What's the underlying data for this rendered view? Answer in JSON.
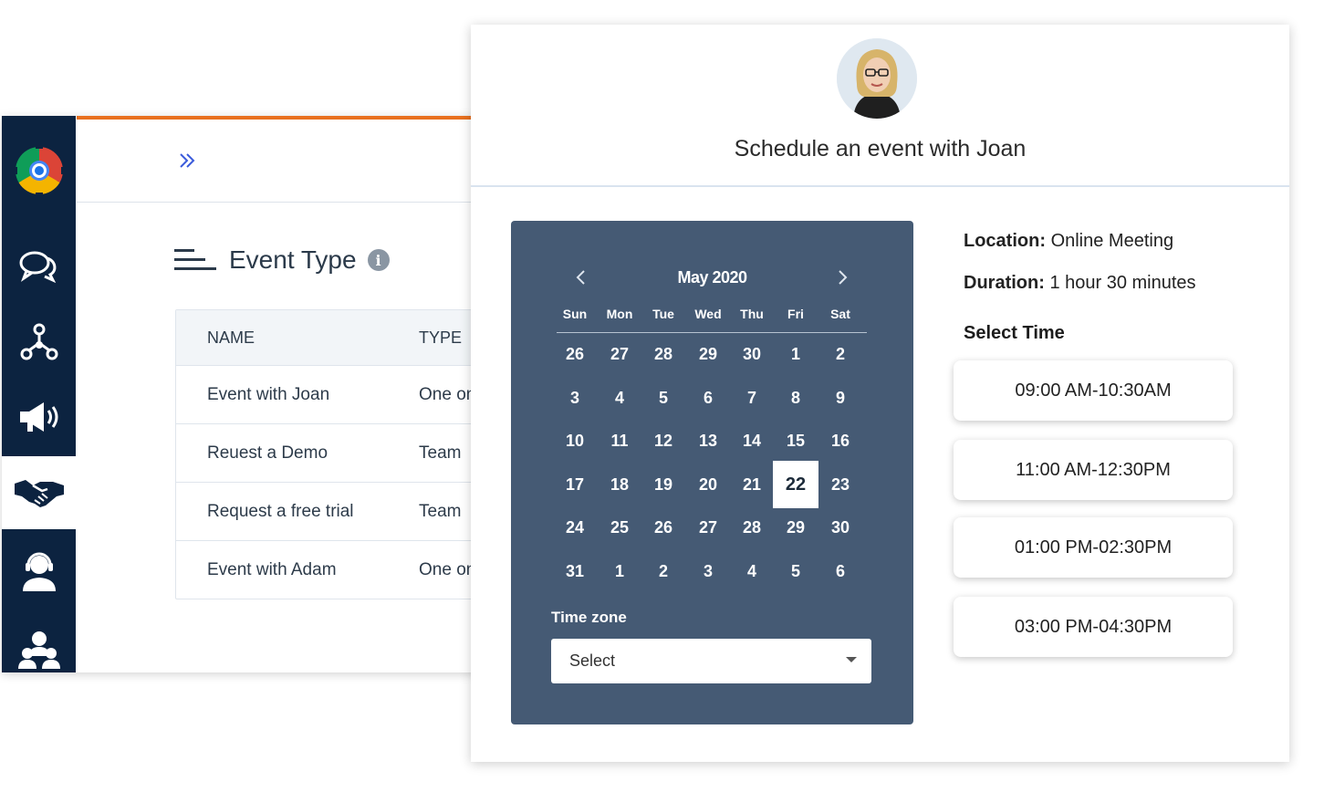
{
  "app": {
    "sidebar": {
      "items": [
        {
          "icon": "logo-gear-icon"
        },
        {
          "icon": "chat-icon"
        },
        {
          "icon": "network-icon"
        },
        {
          "icon": "megaphone-icon"
        },
        {
          "icon": "handshake-icon",
          "active": true
        },
        {
          "icon": "support-agent-icon"
        },
        {
          "icon": "team-icon"
        }
      ]
    },
    "header": {
      "expand_icon": "double-chevron-right-icon"
    },
    "section": {
      "title": "Event Type",
      "info_icon": "info-icon",
      "menu_icon": "menu-lines-icon"
    },
    "table": {
      "headers": {
        "name": "NAME",
        "type": "TYPE"
      },
      "rows": [
        {
          "name": "Event with Joan",
          "type": "One on"
        },
        {
          "name": "Reuest a Demo",
          "type": "Team"
        },
        {
          "name": "Request a free trial",
          "type": "Team"
        },
        {
          "name": "Event with Adam",
          "type": "One on"
        }
      ]
    }
  },
  "scheduler": {
    "title": "Schedule an event with Joan",
    "calendar": {
      "month_label": "May 2020",
      "weekdays": [
        "Sun",
        "Mon",
        "Tue",
        "Wed",
        "Thu",
        "Fri",
        "Sat"
      ],
      "weeks": [
        [
          "26",
          "27",
          "28",
          "29",
          "30",
          "1",
          "2"
        ],
        [
          "3",
          "4",
          "5",
          "6",
          "7",
          "8",
          "9"
        ],
        [
          "10",
          "11",
          "12",
          "13",
          "14",
          "15",
          "16"
        ],
        [
          "17",
          "18",
          "19",
          "20",
          "21",
          "22",
          "23"
        ],
        [
          "24",
          "25",
          "26",
          "27",
          "28",
          "29",
          "30"
        ],
        [
          "31",
          "1",
          "2",
          "3",
          "4",
          "5",
          "6"
        ]
      ],
      "selected_day": "22",
      "timezone_label": "Time zone",
      "timezone_value": "Select"
    },
    "location": {
      "label": "Location:",
      "value": "Online Meeting"
    },
    "duration": {
      "label": "Duration:",
      "value": "1 hour 30 minutes"
    },
    "select_time_label": "Select Time",
    "slots": [
      "09:00 AM-10:30AM",
      "11:00 AM-12:30PM",
      "01:00 PM-02:30PM",
      "03:00 PM-04:30PM"
    ]
  },
  "colors": {
    "sidebar": "#0c2340",
    "accent": "#e8701f",
    "calendar_bg": "#455a74"
  }
}
